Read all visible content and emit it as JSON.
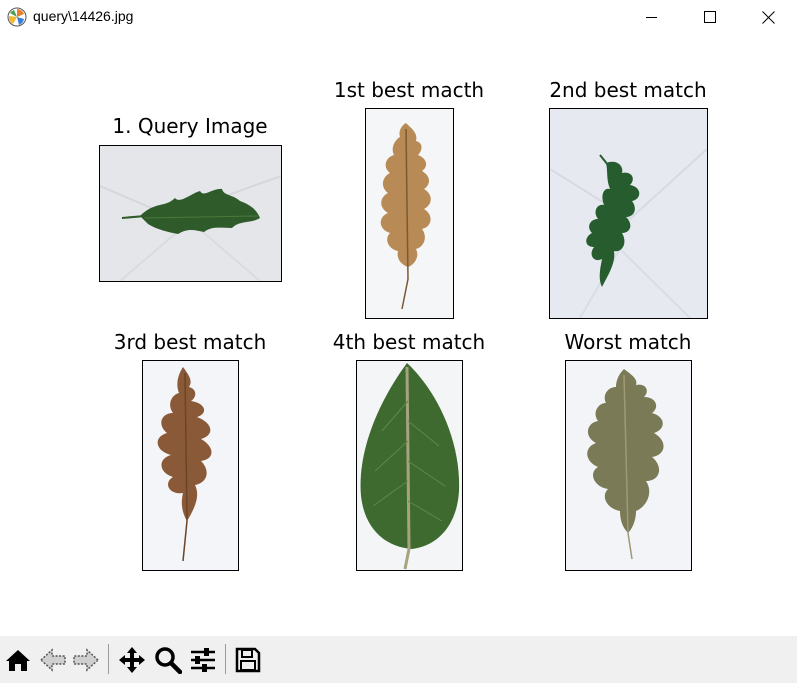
{
  "window": {
    "title": "query\\14426.jpg",
    "icons": [
      "matplotlib-logo-icon",
      "minimize-icon",
      "maximize-icon",
      "close-icon"
    ]
  },
  "figure": {
    "panels": [
      {
        "title": "1. Query Image",
        "image": "green oak leaf lying horizontally on crumpled white paper"
      },
      {
        "title": "1st best macth",
        "image": "dry brown oak leaf, vertical, on white background"
      },
      {
        "title": "2nd best match",
        "image": "dark green lobed oak leaf on crumpled white paper"
      },
      {
        "title": "3rd best match",
        "image": "brown deeply lobed oak leaf, vertical, on white background"
      },
      {
        "title": "4th best match",
        "image": "large green oval leaf with veins, vertical"
      },
      {
        "title": "Worst match",
        "image": "olive green lobed oak leaf, vertical, on white background"
      }
    ]
  },
  "toolbar": {
    "buttons": [
      "home-icon",
      "back-arrow-icon",
      "forward-arrow-icon",
      "pan-icon",
      "zoom-icon",
      "configure-subplots-icon",
      "save-icon"
    ]
  }
}
